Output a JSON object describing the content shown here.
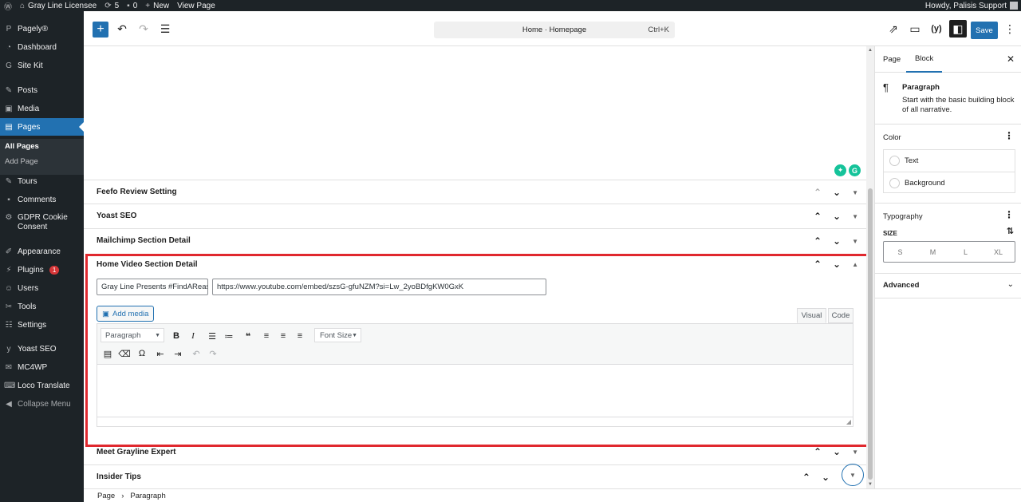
{
  "admin_bar": {
    "site_name": "Gray Line Licensee",
    "updates_count": "5",
    "comments_count": "0",
    "new_label": "New",
    "view_page_label": "View Page",
    "howdy": "Howdy, Palisis Support"
  },
  "sidebar": {
    "items": [
      {
        "label": "Pagely®",
        "icon": "pagely-icon"
      },
      {
        "label": "Dashboard",
        "icon": "dashboard-icon"
      },
      {
        "label": "Site Kit",
        "icon": "sitekit-icon"
      },
      {
        "label": "Posts",
        "icon": "pin-icon"
      },
      {
        "label": "Media",
        "icon": "media-icon"
      },
      {
        "label": "Pages",
        "icon": "pages-icon"
      },
      {
        "label": "Tours",
        "icon": "pin-icon"
      },
      {
        "label": "Comments",
        "icon": "comment-icon"
      },
      {
        "label": "GDPR Cookie Consent",
        "icon": "gear-icon"
      },
      {
        "label": "Appearance",
        "icon": "brush-icon"
      },
      {
        "label": "Plugins",
        "icon": "plug-icon",
        "badge": "1"
      },
      {
        "label": "Users",
        "icon": "user-icon"
      },
      {
        "label": "Tools",
        "icon": "wrench-icon"
      },
      {
        "label": "Settings",
        "icon": "settings-icon"
      },
      {
        "label": "Yoast SEO",
        "icon": "yoast-icon"
      },
      {
        "label": "MC4WP",
        "icon": "mail-icon"
      },
      {
        "label": "Loco Translate",
        "icon": "translate-icon"
      },
      {
        "label": "Collapse Menu",
        "icon": "collapse-icon"
      }
    ],
    "submenu": [
      "All Pages",
      "Add Page"
    ]
  },
  "topbar": {
    "doc_title": "Home · Homepage",
    "shortcut": "Ctrl+K",
    "save_label": "Save"
  },
  "meta_boxes": {
    "feefo": "Feefo Review Setting",
    "yoast": "Yoast SEO",
    "mailchimp": "Mailchimp Section Detail",
    "home_video": "Home Video Section Detail",
    "grayline_expert": "Meet Grayline Expert",
    "insider_tips": "Insider Tips"
  },
  "video_section": {
    "title_value": "Gray Line Presents #FindAReason",
    "url_value": "https://www.youtube.com/embed/szsG-gfuNZM?si=Lw_2yoBDfgKW0GxK",
    "add_media_label": "Add media",
    "tab_visual": "Visual",
    "tab_code": "Code",
    "format_select": "Paragraph",
    "font_size_select": "Font Size"
  },
  "settings_panel": {
    "tab_page": "Page",
    "tab_block": "Block",
    "block_title": "Paragraph",
    "block_desc": "Start with the basic building block of all narrative.",
    "color_heading": "Color",
    "color_text": "Text",
    "color_background": "Background",
    "typography_heading": "Typography",
    "size_label": "SIZE",
    "sizes": [
      "S",
      "M",
      "L",
      "XL"
    ],
    "advanced_heading": "Advanced"
  },
  "footer": {
    "crumb_page": "Page",
    "crumb_block": "Paragraph"
  },
  "colors": {
    "admin_dark": "#1d2327",
    "accent": "#2271b1",
    "highlight_box": "#e0282e",
    "badge_red": "#d63638"
  }
}
